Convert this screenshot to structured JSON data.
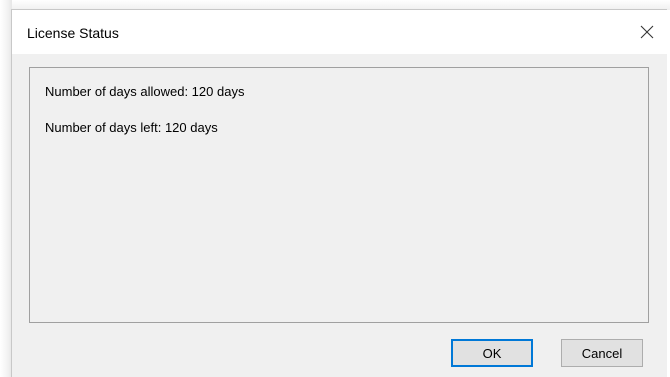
{
  "window": {
    "title": "License Status",
    "close_icon": "close-icon"
  },
  "license": {
    "days_allowed_text": "Number of days allowed: 120 days",
    "days_left_text": "Number of days left: 120 days"
  },
  "buttons": {
    "ok_label": "OK",
    "cancel_label": "Cancel"
  },
  "colors": {
    "focus_border": "#0078d7",
    "dialog_bg": "#f0f0f0",
    "titlebar_bg": "#ffffff"
  }
}
